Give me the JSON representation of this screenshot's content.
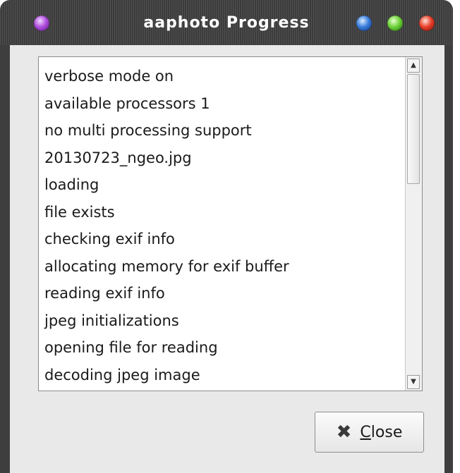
{
  "window": {
    "title": "aaphoto Progress"
  },
  "log": {
    "lines": [
      "verbose mode on",
      "available processors 1",
      "no multi processing support",
      "20130723_ngeo.jpg",
      "loading",
      "file exists",
      "checking exif info",
      "allocating memory for exif buffer",
      "reading exif info",
      "jpeg initializations",
      "opening file for reading",
      "decoding jpeg image"
    ]
  },
  "scrollbar": {
    "up_glyph": "▲",
    "down_glyph": "▼"
  },
  "buttons": {
    "close": {
      "icon": "close-x-icon",
      "glyph": "✖",
      "mnemonic": "C",
      "label_rest": "lose"
    }
  },
  "colors": {
    "titlebar": "#3c3c3c",
    "body": "#e9e9e9",
    "orb_purple": "#b04fdc",
    "orb_blue": "#3a7ddd",
    "orb_green": "#6ed23a",
    "orb_red": "#e8402a"
  }
}
